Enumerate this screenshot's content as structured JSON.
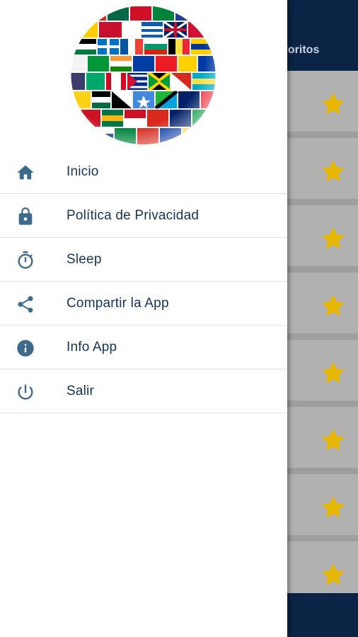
{
  "background_app": {
    "tab_label": "voritos",
    "rows": [
      {
        "star": "star-icon"
      },
      {
        "star": "star-icon"
      },
      {
        "star": "star-icon"
      },
      {
        "star": "star-icon"
      },
      {
        "star": "star-icon"
      },
      {
        "star": "star-icon"
      },
      {
        "star": "star-icon"
      },
      {
        "star": "star-icon"
      }
    ]
  },
  "drawer": {
    "logo": "world-flags-globe",
    "menu": [
      {
        "icon": "home-icon",
        "label": "Inicio"
      },
      {
        "icon": "lock-icon",
        "label": "Política de Privacidad"
      },
      {
        "icon": "timer-icon",
        "label": "Sleep"
      },
      {
        "icon": "share-icon",
        "label": "Compartir la App"
      },
      {
        "icon": "info-icon",
        "label": "Info App"
      },
      {
        "icon": "power-icon",
        "label": "Salir"
      }
    ]
  },
  "colors": {
    "primary_dark": "#0b2446",
    "menu_text": "#153457",
    "icon_color": "#3d6a8a",
    "star": "#e8b800"
  }
}
